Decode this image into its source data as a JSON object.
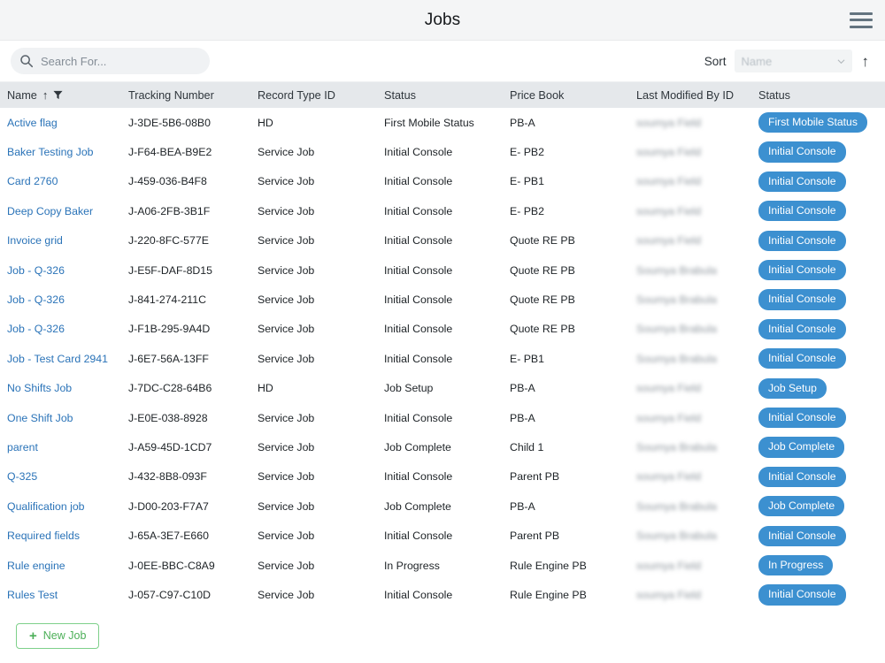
{
  "header": {
    "title": "Jobs",
    "menu_icon": "hamburger-menu-icon"
  },
  "toolbar": {
    "search_placeholder": "Search For...",
    "search_value": "",
    "search_icon": "search-icon",
    "sort_label": "Sort",
    "sort_value": "Name",
    "sort_direction_icon": "arrow-up-icon",
    "chevron_icon": "chevron-down-icon"
  },
  "table": {
    "columns": [
      "Name",
      "Tracking Number",
      "Record Type ID",
      "Status",
      "Price Book",
      "Last Modified By ID",
      "Status"
    ],
    "name_sort_icon": "arrow-up-icon",
    "name_filter_icon": "filter-funnel-icon",
    "rows": [
      {
        "name": "Active flag",
        "tracking": "J-3DE-5B6-08B0",
        "record_type": "HD",
        "status": "First Mobile Status",
        "price_book": "PB-A",
        "modified_by": "soumya Field",
        "badge": "First Mobile Status"
      },
      {
        "name": "Baker Testing Job",
        "tracking": "J-F64-BEA-B9E2",
        "record_type": "Service Job",
        "status": "Initial Console",
        "price_book": "E- PB2",
        "modified_by": "soumya Field",
        "badge": "Initial Console"
      },
      {
        "name": "Card 2760",
        "tracking": "J-459-036-B4F8",
        "record_type": "Service Job",
        "status": "Initial Console",
        "price_book": "E- PB1",
        "modified_by": "soumya Field",
        "badge": "Initial Console"
      },
      {
        "name": "Deep Copy Baker",
        "tracking": "J-A06-2FB-3B1F",
        "record_type": "Service Job",
        "status": "Initial Console",
        "price_book": "E- PB2",
        "modified_by": "soumya Field",
        "badge": "Initial Console"
      },
      {
        "name": "Invoice grid",
        "tracking": "J-220-8FC-577E",
        "record_type": "Service Job",
        "status": "Initial Console",
        "price_book": "Quote RE PB",
        "modified_by": "soumya Field",
        "badge": "Initial Console"
      },
      {
        "name": "Job - Q-326",
        "tracking": "J-E5F-DAF-8D15",
        "record_type": "Service Job",
        "status": "Initial Console",
        "price_book": "Quote RE PB",
        "modified_by": "Soumya Brabula",
        "badge": "Initial Console"
      },
      {
        "name": "Job - Q-326",
        "tracking": "J-841-274-211C",
        "record_type": "Service Job",
        "status": "Initial Console",
        "price_book": "Quote RE PB",
        "modified_by": "Soumya Brabula",
        "badge": "Initial Console"
      },
      {
        "name": "Job - Q-326",
        "tracking": "J-F1B-295-9A4D",
        "record_type": "Service Job",
        "status": "Initial Console",
        "price_book": "Quote RE PB",
        "modified_by": "Soumya Brabula",
        "badge": "Initial Console"
      },
      {
        "name": "Job - Test Card 2941",
        "tracking": "J-6E7-56A-13FF",
        "record_type": "Service Job",
        "status": "Initial Console",
        "price_book": "E- PB1",
        "modified_by": "Soumya Brabula",
        "badge": "Initial Console"
      },
      {
        "name": "No Shifts Job",
        "tracking": "J-7DC-C28-64B6",
        "record_type": "HD",
        "status": "Job Setup",
        "price_book": "PB-A",
        "modified_by": "soumya Field",
        "badge": "Job Setup"
      },
      {
        "name": "One Shift Job",
        "tracking": "J-E0E-038-8928",
        "record_type": "Service Job",
        "status": "Initial Console",
        "price_book": "PB-A",
        "modified_by": "soumya Field",
        "badge": "Initial Console"
      },
      {
        "name": "parent",
        "tracking": "J-A59-45D-1CD7",
        "record_type": "Service Job",
        "status": "Job Complete",
        "price_book": "Child 1",
        "modified_by": "Soumya Brabula",
        "badge": "Job Complete"
      },
      {
        "name": "Q-325",
        "tracking": "J-432-8B8-093F",
        "record_type": "Service Job",
        "status": "Initial Console",
        "price_book": "Parent PB",
        "modified_by": "soumya Field",
        "badge": "Initial Console"
      },
      {
        "name": "Qualification job",
        "tracking": "J-D00-203-F7A7",
        "record_type": "Service Job",
        "status": "Job Complete",
        "price_book": "PB-A",
        "modified_by": "Soumya Brabula",
        "badge": "Job Complete"
      },
      {
        "name": "Required fields",
        "tracking": "J-65A-3E7-E660",
        "record_type": "Service Job",
        "status": "Initial Console",
        "price_book": "Parent PB",
        "modified_by": "Soumya Brabula",
        "badge": "Initial Console"
      },
      {
        "name": "Rule engine",
        "tracking": "J-0EE-BBC-C8A9",
        "record_type": "Service Job",
        "status": "In Progress",
        "price_book": "Rule Engine PB",
        "modified_by": "soumya Field",
        "badge": "In Progress"
      },
      {
        "name": "Rules Test",
        "tracking": "J-057-C97-C10D",
        "record_type": "Service Job",
        "status": "Initial Console",
        "price_book": "Rule Engine PB",
        "modified_by": "soumya Field",
        "badge": "Initial Console"
      }
    ]
  },
  "footer": {
    "new_job_label": "New Job",
    "new_job_icon": "plus-icon"
  },
  "colors": {
    "topbar_bg": "#f4f5f6",
    "table_header_bg": "#e5e8eb",
    "badge_bg": "#3c90d0",
    "link": "#2a73b8",
    "new_button_accent": "#4caf58"
  }
}
